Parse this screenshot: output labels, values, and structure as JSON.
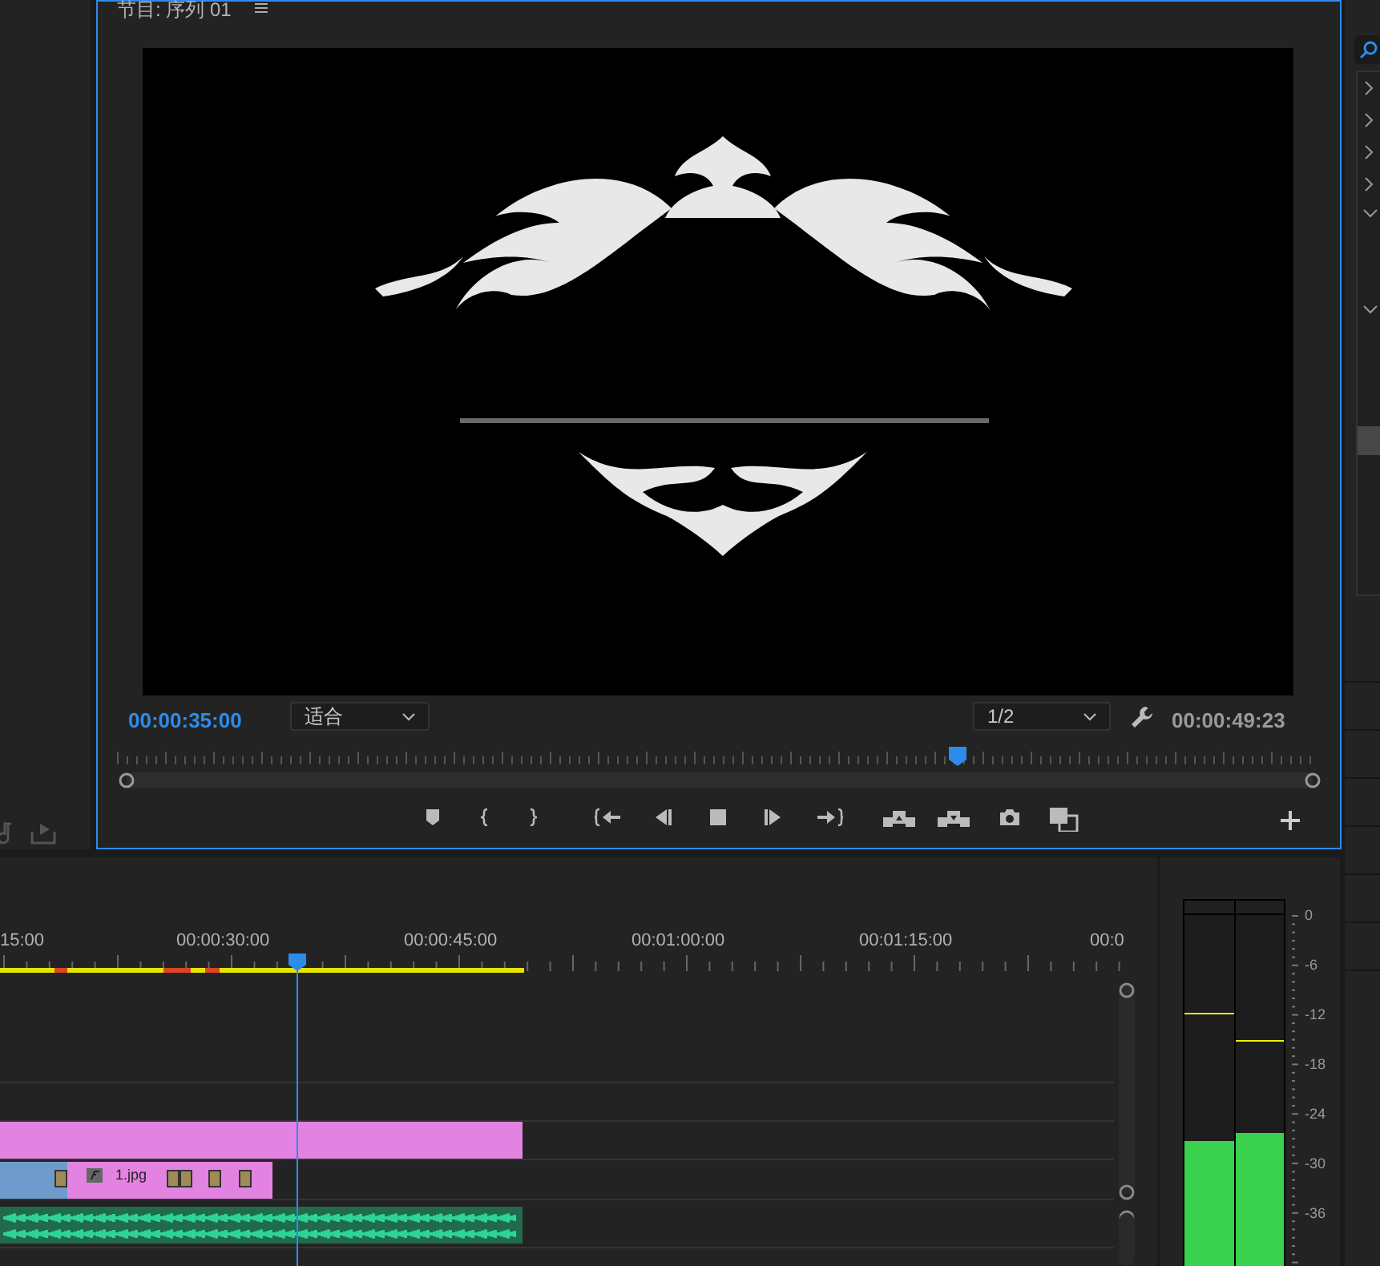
{
  "program_monitor": {
    "title": "节目: 序列 01",
    "timecode": "00:00:35:00",
    "zoom": "适合",
    "resolution": "1/2",
    "duration": "00:00:49:23",
    "scrubber": {
      "level": 0.7
    }
  },
  "timeline": {
    "ruler_labels": [
      "15:00",
      "00:00:30:00",
      "00:00:45:00",
      "00:01:00:00",
      "00:01:15:00",
      "00:0"
    ],
    "clips": [
      {
        "kind": "video",
        "color": "#e383e1"
      },
      {
        "kind": "video",
        "color": "#6f9bcc"
      },
      {
        "kind": "video",
        "color": "#e383e1",
        "label": "1.jpg"
      },
      {
        "kind": "audio",
        "color": "#1f6b4c"
      }
    ]
  },
  "audio_meter": {
    "channels": [
      {
        "level": 0.35
      },
      {
        "level": 0.37
      }
    ],
    "scale": [
      "0",
      "-6",
      "-12",
      "-18",
      "-24",
      "-30",
      "-36"
    ]
  }
}
